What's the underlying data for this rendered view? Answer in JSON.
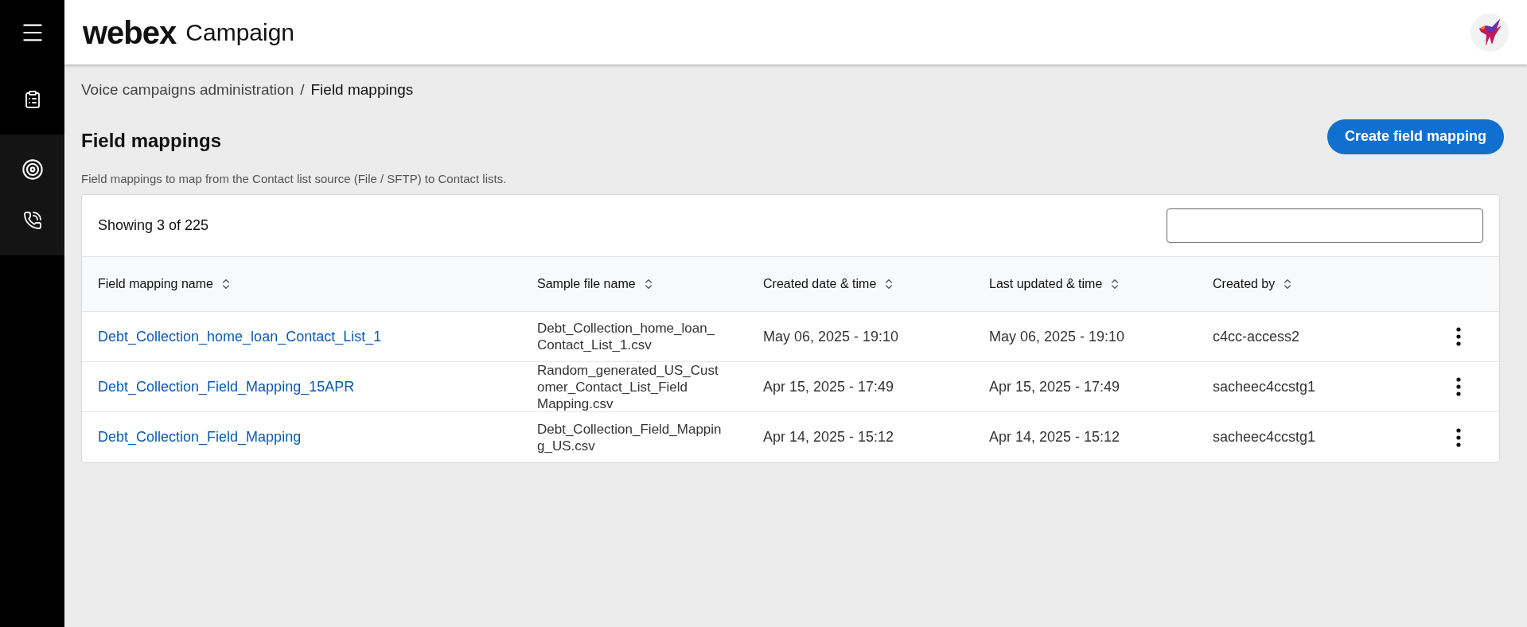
{
  "nav": {
    "sections": [
      {
        "highlighted": false,
        "items": [
          {
            "kind": "list"
          }
        ]
      },
      {
        "highlighted": true,
        "items": [
          {
            "kind": "target"
          },
          {
            "kind": "phone"
          }
        ]
      }
    ]
  },
  "header": {
    "brand": "webex",
    "product": "Campaign"
  },
  "breadcrumb": {
    "parent": "Voice campaigns administration",
    "separator": "/",
    "current": "Field mappings"
  },
  "page": {
    "title": "Field mappings",
    "description": "Field mappings to map from the Contact list source (File / SFTP) to Contact lists.",
    "create_button": "Create field mapping"
  },
  "table": {
    "count": "Showing 3 of 225",
    "columns": [
      "Field mapping name",
      "Sample file name",
      "Created date & time",
      "Last updated & time",
      "Created by"
    ],
    "rows": [
      {
        "name": "Debt_Collection_home_loan_Contact_List_1",
        "sample_file": [
          "Debt_Collection_home_loan_",
          "Contact_List_1.csv"
        ],
        "created": "May 06, 2025 - 19:10",
        "updated": "May 06, 2025 - 19:10",
        "created_by": "c4cc-access2"
      },
      {
        "name": "Debt_Collection_Field_Mapping_15APR",
        "sample_file": [
          "Random_generated_US_Cust",
          "omer_Contact_List_Field",
          "Mapping.csv"
        ],
        "created": "Apr 15, 2025 - 17:49",
        "updated": "Apr 15, 2025 - 17:49",
        "created_by": "sacheec4ccstg1"
      },
      {
        "name": "Debt_Collection_Field_Mapping",
        "sample_file": [
          "Debt_Collection_Field_Mappin",
          "g_US.csv"
        ],
        "created": "Apr 14, 2025 - 15:12",
        "updated": "Apr 14, 2025 - 15:12",
        "created_by": "sacheec4ccstg1"
      }
    ]
  }
}
